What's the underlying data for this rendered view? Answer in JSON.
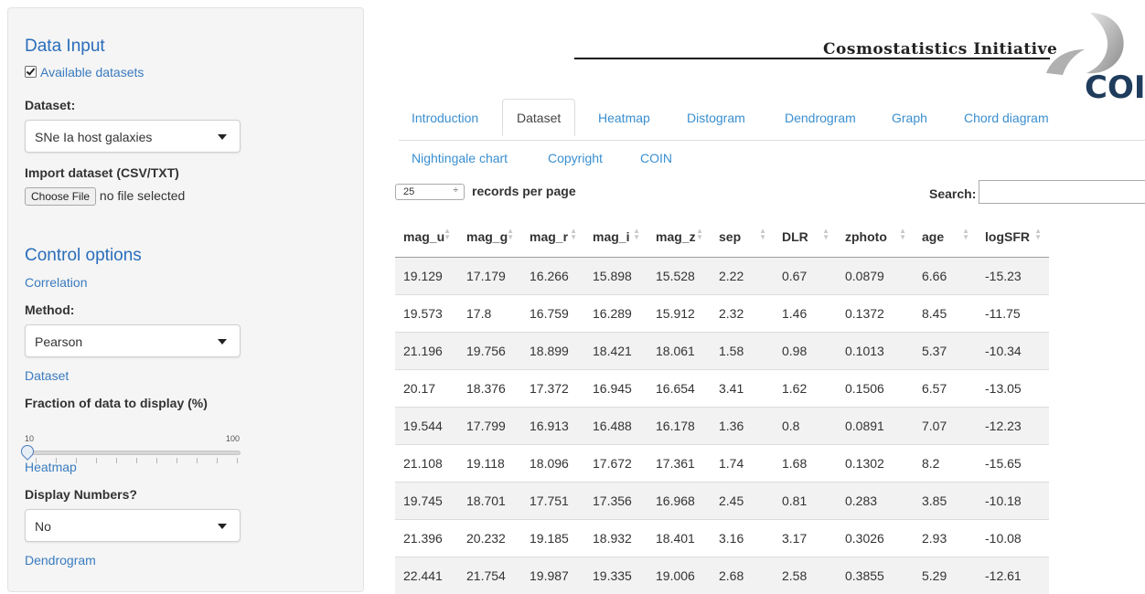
{
  "sidebar": {
    "data_input_heading": "Data Input",
    "available_datasets_label": "Available datasets",
    "available_datasets_checked": true,
    "dataset_label": "Dataset:",
    "dataset_value": "SNe Ia host galaxies",
    "import_label": "Import dataset (CSV/TXT)",
    "choose_file_button": "Choose File",
    "no_file_text": "no file selected",
    "control_heading": "Control options",
    "correlation_link": "Correlation",
    "method_label": "Method:",
    "method_value": "Pearson",
    "dataset_link": "Dataset",
    "fraction_label": "Fraction of data to display (%)",
    "slider_min": "10",
    "slider_max": "100",
    "slider_value_percent": 10,
    "heatmap_link": "Heatmap",
    "display_numbers_label": "Display Numbers?",
    "display_numbers_value": "No",
    "dendrogram_link": "Dendrogram"
  },
  "header": {
    "logo_text": "Cosmostatistics Initiative",
    "logo_abbrev": "COI"
  },
  "tabs": [
    {
      "label": "Introduction",
      "active": false
    },
    {
      "label": "Dataset",
      "active": true
    },
    {
      "label": "Heatmap",
      "active": false
    },
    {
      "label": "Distogram",
      "active": false
    },
    {
      "label": "Dendrogram",
      "active": false
    },
    {
      "label": "Graph",
      "active": false
    },
    {
      "label": "Chord diagram",
      "active": false
    },
    {
      "label": "Nightingale chart",
      "active": false
    },
    {
      "label": "Copyright",
      "active": false
    },
    {
      "label": "COIN",
      "active": false
    }
  ],
  "table_controls": {
    "page_length": "25",
    "page_length_arrow": "÷",
    "records_text": "records per page",
    "search_label": "Search:",
    "search_value": ""
  },
  "table": {
    "columns": [
      "mag_u",
      "mag_g",
      "mag_r",
      "mag_i",
      "mag_z",
      "sep",
      "DLR",
      "zphoto",
      "age",
      "logSFR"
    ],
    "rows": [
      [
        "19.129",
        "17.179",
        "16.266",
        "15.898",
        "15.528",
        "2.22",
        "0.67",
        "0.0879",
        "6.66",
        "-15.23"
      ],
      [
        "19.573",
        "17.8",
        "16.759",
        "16.289",
        "15.912",
        "2.32",
        "1.46",
        "0.1372",
        "8.45",
        "-11.75"
      ],
      [
        "21.196",
        "19.756",
        "18.899",
        "18.421",
        "18.061",
        "1.58",
        "0.98",
        "0.1013",
        "5.37",
        "-10.34"
      ],
      [
        "20.17",
        "18.376",
        "17.372",
        "16.945",
        "16.654",
        "3.41",
        "1.62",
        "0.1506",
        "6.57",
        "-13.05"
      ],
      [
        "19.544",
        "17.799",
        "16.913",
        "16.488",
        "16.178",
        "1.36",
        "0.8",
        "0.0891",
        "7.07",
        "-12.23"
      ],
      [
        "21.108",
        "19.118",
        "18.096",
        "17.672",
        "17.361",
        "1.74",
        "1.68",
        "0.1302",
        "8.2",
        "-15.65"
      ],
      [
        "19.745",
        "18.701",
        "17.751",
        "17.356",
        "16.968",
        "2.45",
        "0.81",
        "0.283",
        "3.85",
        "-10.18"
      ],
      [
        "21.396",
        "20.232",
        "19.185",
        "18.932",
        "18.401",
        "3.16",
        "3.17",
        "0.3026",
        "2.93",
        "-10.08"
      ],
      [
        "22.441",
        "21.754",
        "19.987",
        "19.335",
        "19.006",
        "2.68",
        "2.58",
        "0.3855",
        "5.29",
        "-12.61"
      ]
    ]
  },
  "colors": {
    "link_blue": "#3a8fd0",
    "heading_blue": "#2a6ebb",
    "sidebar_bg": "#f5f5f5",
    "row_stripe": "#f2f2f2"
  }
}
